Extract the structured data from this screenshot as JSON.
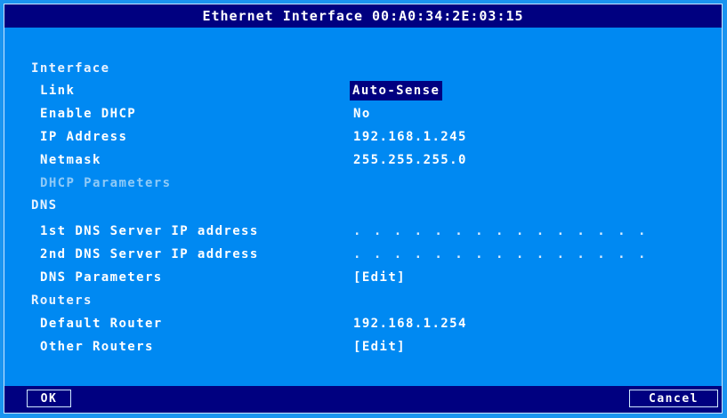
{
  "window": {
    "title": "Ethernet Interface 00:A0:34:2E:03:15"
  },
  "interface": {
    "section_label": "Interface",
    "link_label": "Link",
    "link_value": "Auto-Sense",
    "dhcp_label": "Enable DHCP",
    "dhcp_value": "No",
    "ip_label": "IP Address",
    "ip_value": "192.168.1.245",
    "netmask_label": "Netmask",
    "netmask_value": "255.255.255.0",
    "dhcp_params_label": "DHCP Parameters"
  },
  "dns": {
    "section_label": "DNS",
    "dns1_label": "1st DNS Server IP address",
    "dns1_value": ". . . . . . . . . . . . . . .",
    "dns2_label": "2nd DNS Server IP address",
    "dns2_value": ". . . . . . . . . . . . . . .",
    "params_label": "DNS Parameters",
    "params_value": "[Edit]"
  },
  "routers": {
    "section_label": "Routers",
    "default_label": "Default Router",
    "default_value": "192.168.1.254",
    "other_label": "Other Routers",
    "other_value": "[Edit]"
  },
  "buttons": {
    "ok": "OK",
    "cancel": "Cancel"
  }
}
